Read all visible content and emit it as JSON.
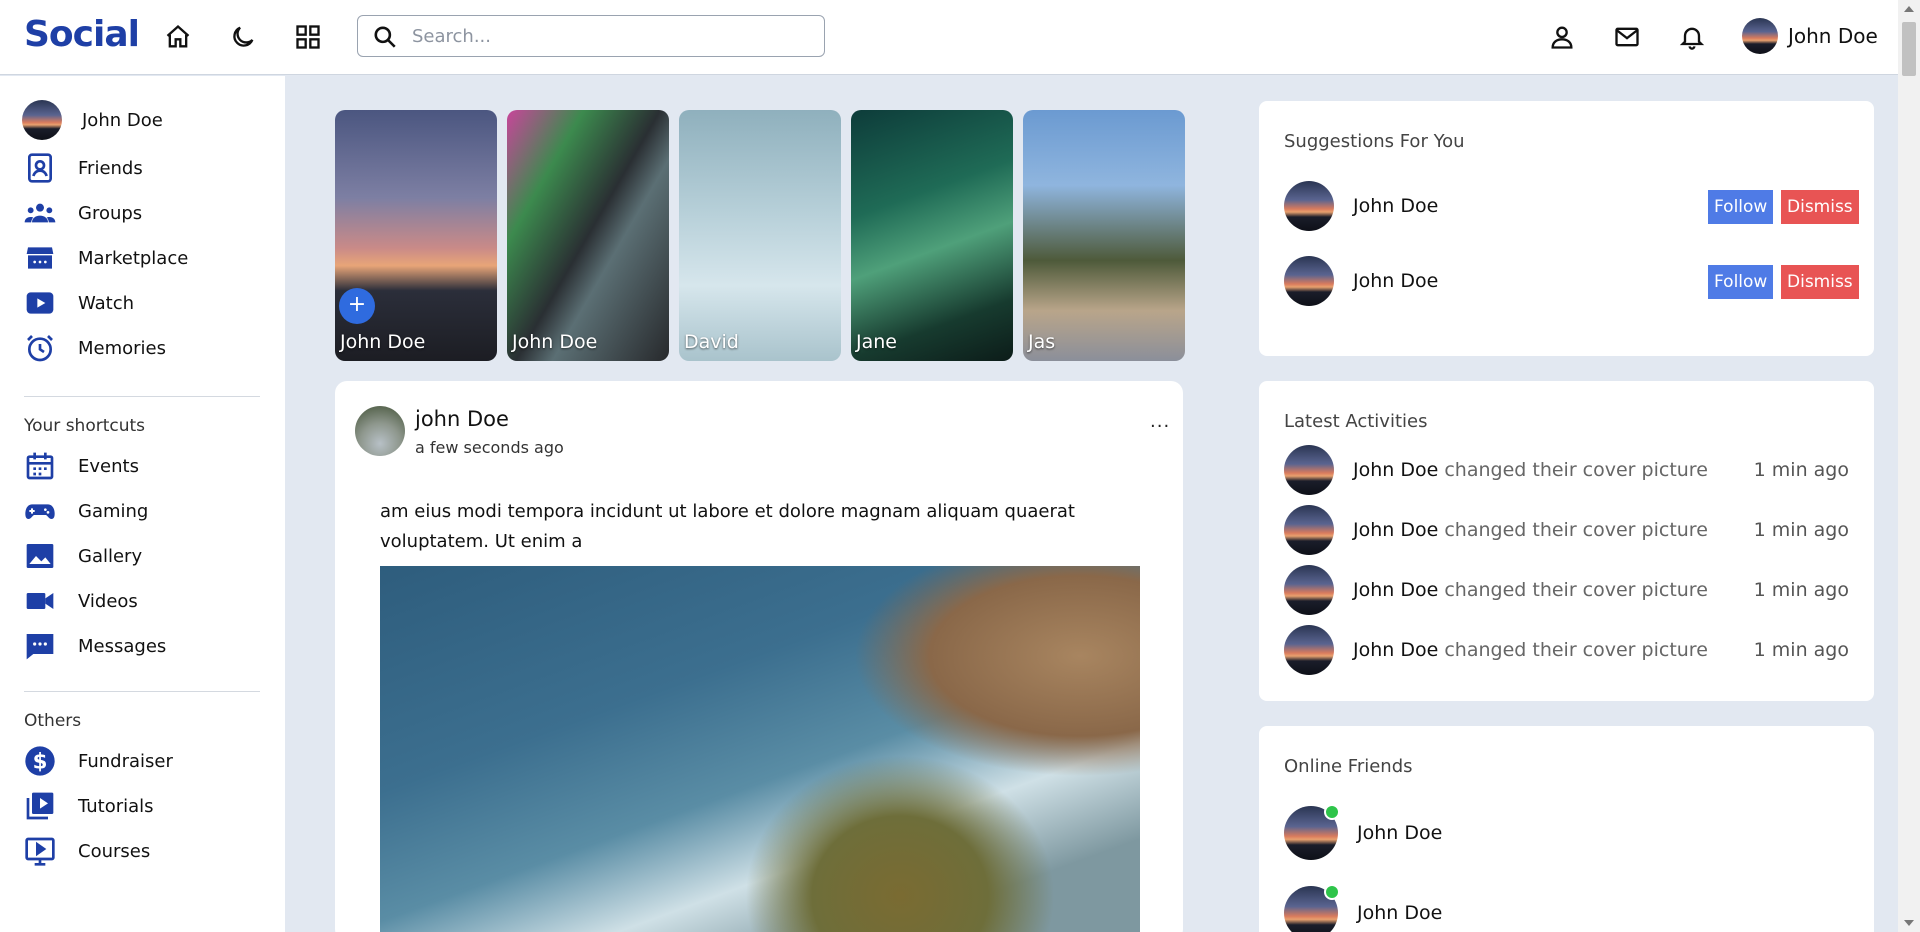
{
  "topbar": {
    "logo": "Social",
    "search_placeholder": "Search...",
    "icons": [
      "home-icon",
      "moon-icon",
      "apps-grid-icon",
      "person-icon",
      "mail-icon",
      "bell-icon"
    ],
    "user_name": "John Doe"
  },
  "sidebar": {
    "profile": {
      "name": "John Doe"
    },
    "items": [
      {
        "label": "Friends",
        "icon": "friends-icon"
      },
      {
        "label": "Groups",
        "icon": "groups-icon"
      },
      {
        "label": "Marketplace",
        "icon": "store-icon"
      },
      {
        "label": "Watch",
        "icon": "play-icon"
      },
      {
        "label": "Memories",
        "icon": "alarm-clock-icon"
      }
    ],
    "shortcuts_heading": "Your shortcuts",
    "shortcuts": [
      {
        "label": "Events",
        "icon": "calendar-icon"
      },
      {
        "label": "Gaming",
        "icon": "gamepad-icon"
      },
      {
        "label": "Gallery",
        "icon": "image-icon"
      },
      {
        "label": "Videos",
        "icon": "video-camera-icon"
      },
      {
        "label": "Messages",
        "icon": "chat-icon"
      }
    ],
    "others_heading": "Others",
    "others": [
      {
        "label": "Fundraiser",
        "icon": "dollar-icon"
      },
      {
        "label": "Tutorials",
        "icon": "video-library-icon"
      },
      {
        "label": "Courses",
        "icon": "monitor-play-icon"
      }
    ]
  },
  "stories": [
    {
      "name": "John Doe",
      "add_label": "+"
    },
    {
      "name": "John Doe"
    },
    {
      "name": "David"
    },
    {
      "name": "Jane"
    },
    {
      "name": "Jas"
    }
  ],
  "post": {
    "author": "john Doe",
    "time": "a few seconds ago",
    "menu": "...",
    "text": "am eius modi tempora incidunt ut labore et dolore magnam aliquam quaerat voluptatem. Ut enim a"
  },
  "suggestions": {
    "title": "Suggestions For You",
    "users": [
      {
        "name": "John Doe",
        "follow": "Follow",
        "dismiss": "Dismiss"
      },
      {
        "name": "John Doe",
        "follow": "Follow",
        "dismiss": "Dismiss"
      }
    ]
  },
  "activities": {
    "title": "Latest Activities",
    "items": [
      {
        "name": "John Doe",
        "action": "changed their cover picture",
        "time": "1 min ago"
      },
      {
        "name": "John Doe",
        "action": "changed their cover picture",
        "time": "1 min ago"
      },
      {
        "name": "John Doe",
        "action": "changed their cover picture",
        "time": "1 min ago"
      },
      {
        "name": "John Doe",
        "action": "changed their cover picture",
        "time": "1 min ago"
      }
    ]
  },
  "online_friends": {
    "title": "Online Friends",
    "items": [
      {
        "name": "John Doe"
      },
      {
        "name": "John Doe"
      }
    ]
  },
  "colors": {
    "brand": "#1e3fa6",
    "background": "#e2e8f1",
    "follow": "#4f7be6",
    "dismiss": "#e85454",
    "online": "#2ec44a"
  }
}
